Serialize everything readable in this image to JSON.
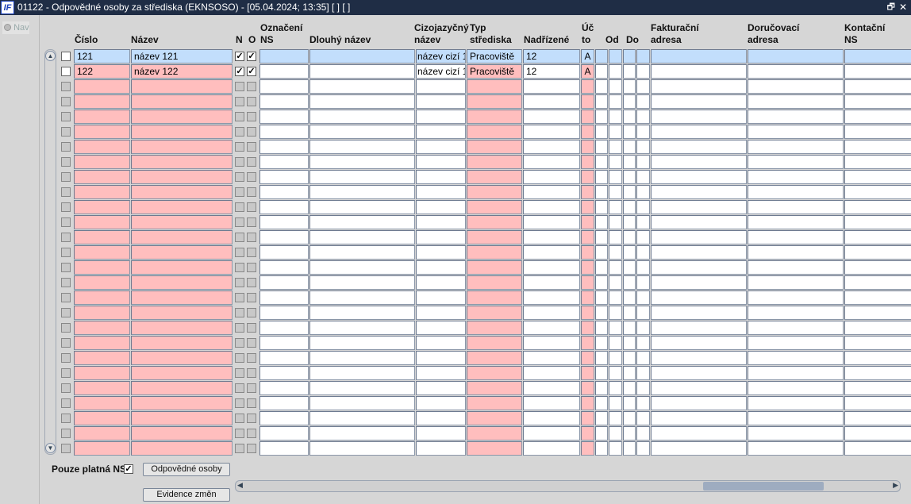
{
  "window": {
    "title": "01122 - Odpovědné osoby za střediska (EKNSOSO) - [05.04.2024; 13:35]  [ ] [ ]",
    "logo": "IF"
  },
  "nav": {
    "label": "Nav"
  },
  "headers": {
    "cislo": "Číslo",
    "nazev": "Název",
    "n": "N",
    "o": "O",
    "oznaceni_1": "Označení",
    "oznaceni_2": "NS",
    "dlouhy": "Dlouhý název",
    "cizo_1": "Cizojazyčný",
    "cizo_2": "název",
    "typ_1": "Typ",
    "typ_2": "střediska",
    "nadrizene": "Nadřízené",
    "ucto_1": "Úč",
    "ucto_2": "to",
    "od": "Od",
    "do": "Do",
    "fakt_1": "Fakturační",
    "fakt_2": "adresa",
    "dor_1": "Doručovací",
    "dor_2": "adresa",
    "kont_1": "Kontační",
    "kont_2": "NS"
  },
  "rows": [
    {
      "cislo": "121",
      "nazev": "název 121",
      "n": true,
      "o": true,
      "cizo": "název cizí 1",
      "typ": "Pracoviště",
      "nadrizene": "12",
      "ucto": "A",
      "selected": true
    },
    {
      "cislo": "122",
      "nazev": "název 122",
      "n": true,
      "o": true,
      "cizo": "název cizí 1",
      "typ": "Pracoviště",
      "nadrizene": "12",
      "ucto": "A",
      "selected": false
    }
  ],
  "empty_row_count": 25,
  "footer": {
    "pouze_label": "Pouze platná NS",
    "pouze_checked": true,
    "btn_osoby": "Odpovědné osoby",
    "btn_evidence": "Evidence změn"
  },
  "hscroll_position_pct": 88
}
